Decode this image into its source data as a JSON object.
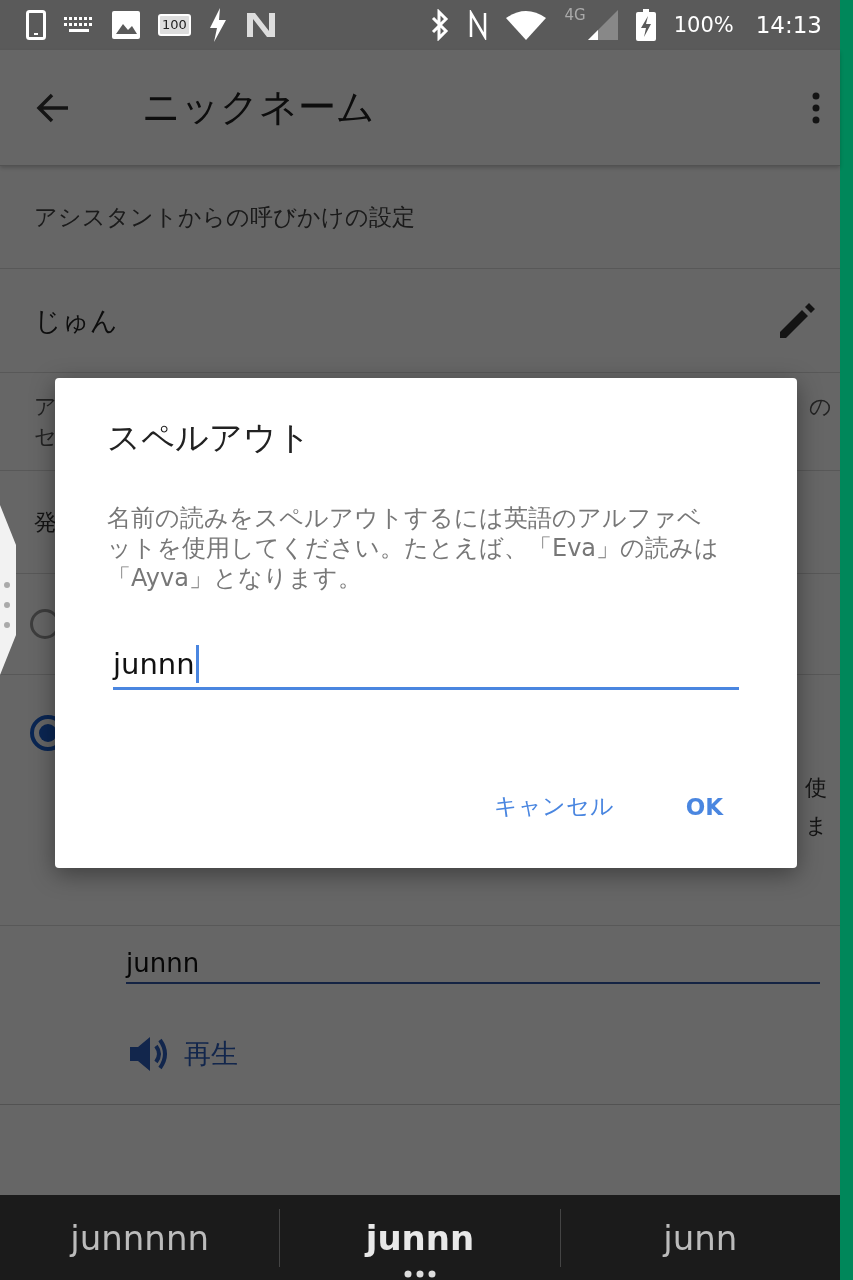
{
  "status_bar": {
    "calendar_badge": "100",
    "network": "4G",
    "battery": "100%",
    "time": "14:13"
  },
  "app_bar": {
    "title": "ニックネーム"
  },
  "settings": {
    "section_header": "アシスタントからの呼びかけの設定",
    "nickname": "じゅん",
    "description_fragments": {
      "line_1_start": "ア",
      "line_1_end": "の",
      "line_2_start": "セ"
    },
    "pronunciation_label_fragment": "発",
    "options": [
      {
        "selected": false
      },
      {
        "selected": true,
        "text_fragments": [
          "使",
          "ま"
        ]
      }
    ],
    "pronunciation_field": {
      "value": "junnn"
    },
    "play_button": "再生"
  },
  "dialog": {
    "title": "スペルアウト",
    "message": "名前の読みをスペルアウトするには英語のアルファベットを使用してください。たとえば、「Eva」の読みは「Ayva」となります。",
    "input": {
      "value": "junnn"
    },
    "buttons": [
      "キャンセル",
      "OK"
    ]
  },
  "suggestions": [
    {
      "text": "junnnnn",
      "selected": false
    },
    {
      "text": "junnn",
      "selected": true
    },
    {
      "text": "junn",
      "selected": false
    }
  ]
}
